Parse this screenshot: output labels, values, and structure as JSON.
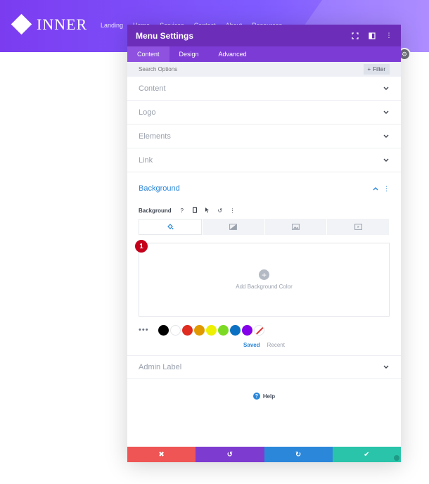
{
  "site": {
    "logo_text": "INNER",
    "nav": [
      "Landing",
      "Home",
      "Services",
      "Contact",
      "About",
      "Resources"
    ]
  },
  "modal": {
    "title": "Menu Settings",
    "tabs": [
      {
        "label": "Content",
        "active": true
      },
      {
        "label": "Design",
        "active": false
      },
      {
        "label": "Advanced",
        "active": false
      }
    ],
    "search_placeholder": "Search Options",
    "filter_label": "Filter",
    "sections": [
      {
        "label": "Content"
      },
      {
        "label": "Logo"
      },
      {
        "label": "Elements"
      },
      {
        "label": "Link"
      }
    ],
    "background": {
      "title": "Background",
      "field_label": "Background",
      "badge": "1",
      "add_label": "Add Background Color",
      "swatches": [
        "#000000",
        "#ffffff",
        "#e02b20",
        "#e09900",
        "#edf000",
        "#7cda24",
        "#0c71c3",
        "#8300e9"
      ],
      "saved_label": "Saved",
      "recent_label": "Recent"
    },
    "admin_label": "Admin Label",
    "help_label": "Help"
  },
  "colors": {
    "header_purple": "#6c2eb9",
    "accent_blue": "#2b87da",
    "cancel_red": "#ef5555",
    "save_teal": "#29c4a9"
  }
}
